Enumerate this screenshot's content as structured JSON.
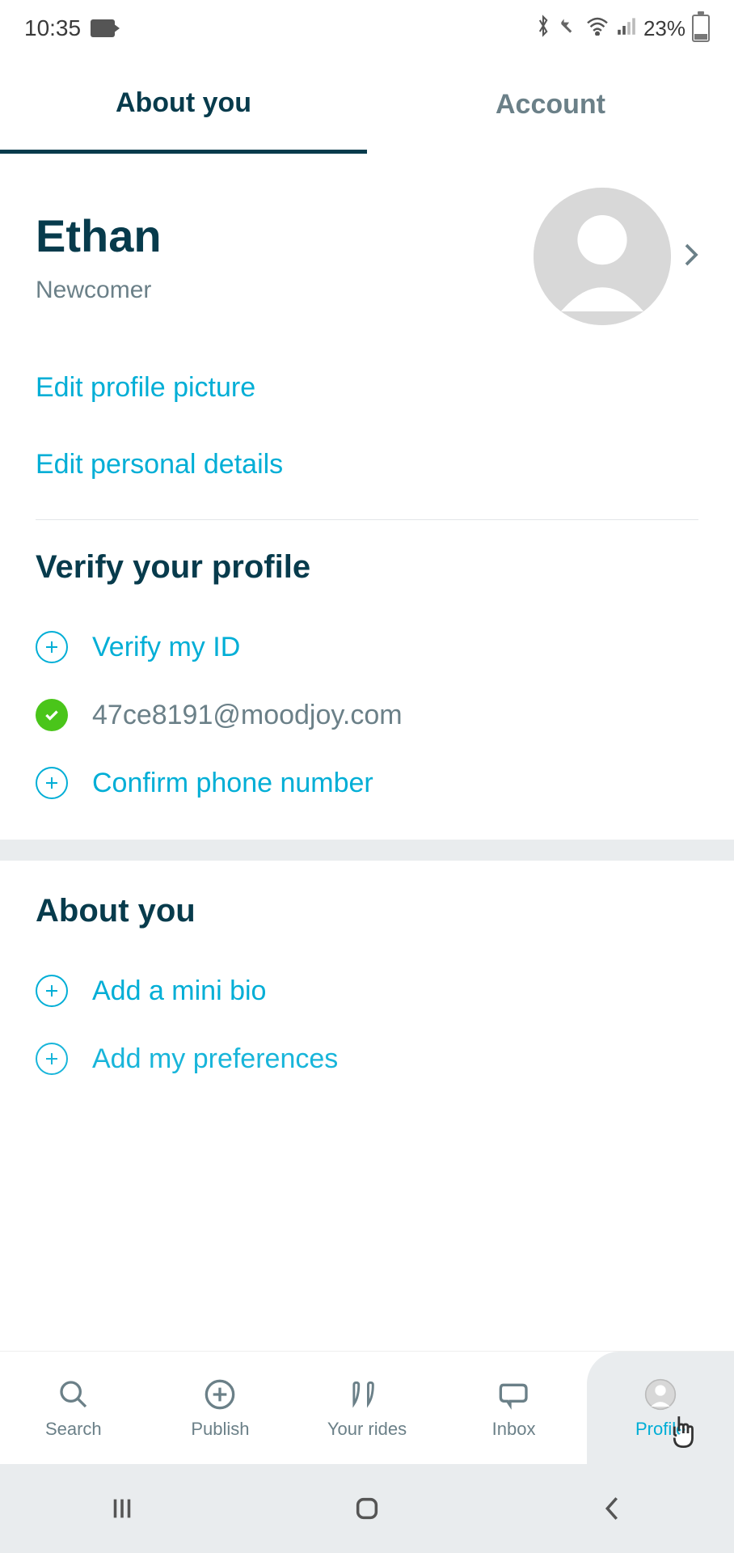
{
  "status": {
    "time": "10:35",
    "battery_pct": "23%"
  },
  "tabs": {
    "about": "About you",
    "account": "Account"
  },
  "profile": {
    "name": "Ethan",
    "role": "Newcomer"
  },
  "links": {
    "edit_picture": "Edit profile picture",
    "edit_details": "Edit personal details"
  },
  "verify": {
    "title": "Verify your profile",
    "id": "Verify my ID",
    "email": "47ce8191@moodjoy.com",
    "phone": "Confirm phone number"
  },
  "about": {
    "title": "About you",
    "bio": "Add a mini bio",
    "prefs": "Add my preferences"
  },
  "tooltip": "Profile",
  "nav": {
    "search": "Search",
    "publish": "Publish",
    "rides": "Your rides",
    "inbox": "Inbox",
    "profile": "Profile"
  }
}
